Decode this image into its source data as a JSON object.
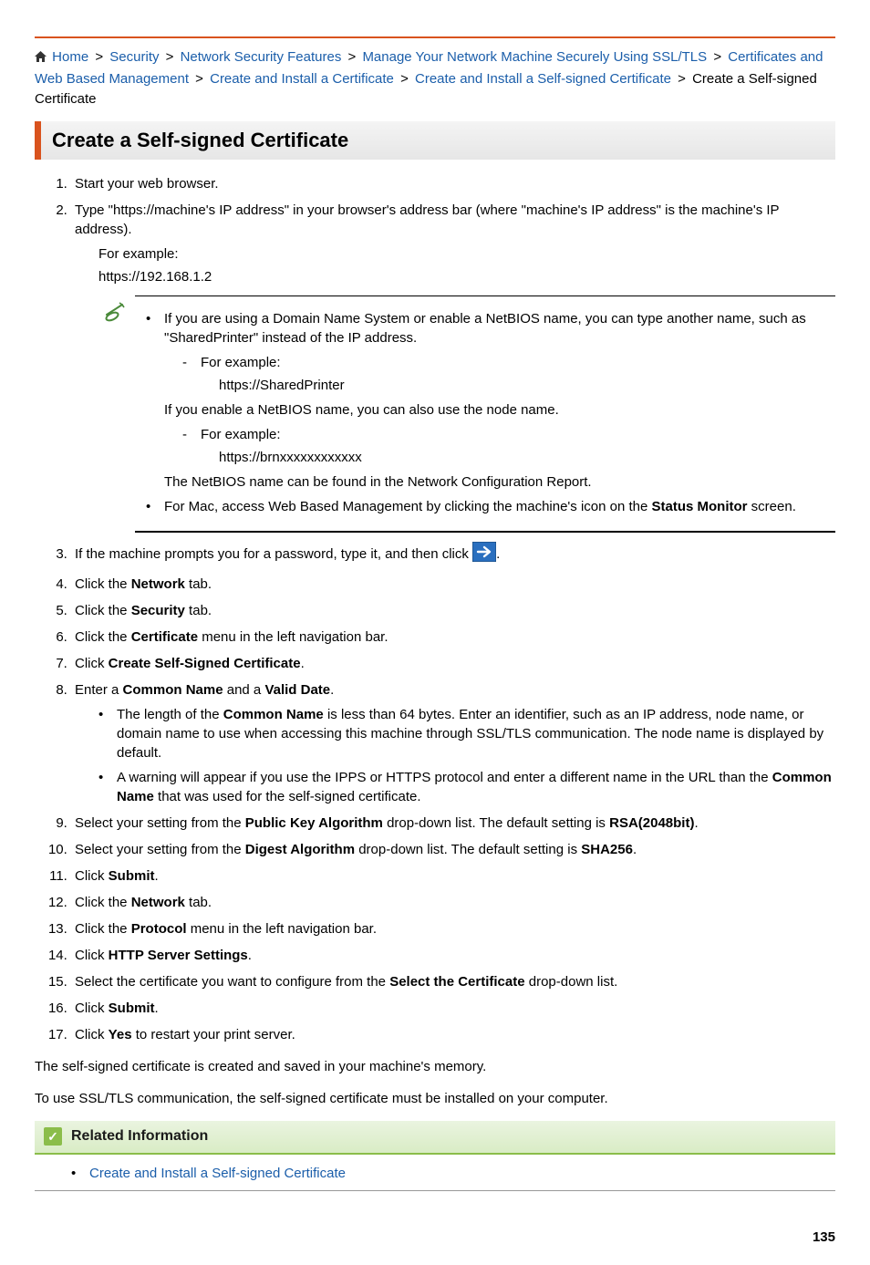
{
  "breadcrumb": {
    "home": "Home",
    "items": [
      "Security",
      "Network Security Features",
      "Manage Your Network Machine Securely Using SSL/TLS",
      "Certificates and Web Based Management",
      "Create and Install a Certificate",
      "Create and Install a Self-signed Certificate"
    ],
    "current": "Create a Self-signed Certificate",
    "sep": ">"
  },
  "title": "Create a Self-signed Certificate",
  "steps": {
    "s1": "Start your web browser.",
    "s2": "Type \"https://machine's IP address\" in your browser's address bar (where \"machine's IP address\" is the machine's IP address).",
    "s2_eg_label": "For example:",
    "s2_eg_value": "https://192.168.1.2",
    "note": {
      "b1": "If you are using a Domain Name System or enable a NetBIOS name, you can type another name, such as \"SharedPrinter\" instead of the IP address.",
      "b1_eg_label": "For example:",
      "b1_eg_value": "https://SharedPrinter",
      "b1_p2": "If you enable a NetBIOS name, you can also use the node name.",
      "b1_eg2_label": "For example:",
      "b1_eg2_value": "https://brnxxxxxxxxxxxx",
      "b1_p3": "The NetBIOS name can be found in the Network Configuration Report.",
      "b2_pre": "For Mac, access Web Based Management by clicking the machine's icon on the ",
      "b2_bold": "Status Monitor",
      "b2_post": " screen."
    },
    "s3_pre": "If the machine prompts you for a password, type it, and then click ",
    "s3_post": ".",
    "s4_pre": "Click the ",
    "s4_bold": "Network",
    "s4_post": " tab.",
    "s5_pre": "Click the ",
    "s5_bold": "Security",
    "s5_post": " tab.",
    "s6_pre": "Click the ",
    "s6_bold": "Certificate",
    "s6_post": " menu in the left navigation bar.",
    "s7_pre": "Click ",
    "s7_bold": "Create Self-Signed Certificate",
    "s7_post": ".",
    "s8_pre": "Enter a ",
    "s8_b1": "Common Name",
    "s8_mid": " and a ",
    "s8_b2": "Valid Date",
    "s8_post": ".",
    "s8_sub1_pre": "The length of the ",
    "s8_sub1_bold": "Common Name",
    "s8_sub1_post": " is less than 64 bytes. Enter an identifier, such as an IP address, node name, or domain name to use when accessing this machine through SSL/TLS communication. The node name is displayed by default.",
    "s8_sub2_pre": "A warning will appear if you use the IPPS or HTTPS protocol and enter a different name in the URL than the ",
    "s8_sub2_bold": "Common Name",
    "s8_sub2_post": " that was used for the self-signed certificate.",
    "s9_pre": "Select your setting from the ",
    "s9_bold": "Public Key Algorithm",
    "s9_mid": " drop-down list. The default setting is ",
    "s9_bold2": "RSA(2048bit)",
    "s9_post": ".",
    "s10_pre": "Select your setting from the ",
    "s10_bold": "Digest Algorithm",
    "s10_mid": " drop-down list. The default setting is ",
    "s10_bold2": "SHA256",
    "s10_post": ".",
    "s11_pre": "Click ",
    "s11_bold": "Submit",
    "s11_post": ".",
    "s12_pre": "Click the ",
    "s12_bold": "Network",
    "s12_post": " tab.",
    "s13_pre": "Click the ",
    "s13_bold": "Protocol",
    "s13_post": " menu in the left navigation bar.",
    "s14_pre": "Click ",
    "s14_bold": "HTTP Server Settings",
    "s14_post": ".",
    "s15_pre": "Select the certificate you want to configure from the ",
    "s15_bold": "Select the Certificate",
    "s15_post": " drop-down list.",
    "s16_pre": "Click ",
    "s16_bold": "Submit",
    "s16_post": ".",
    "s17_pre": "Click ",
    "s17_bold": "Yes",
    "s17_post": " to restart your print server."
  },
  "closing1": "The self-signed certificate is created and saved in your machine's memory.",
  "closing2": "To use SSL/TLS communication, the self-signed certificate must be installed on your computer.",
  "related": {
    "title": "Related Information",
    "link": "Create and Install a Self-signed Certificate"
  },
  "page_number": "135"
}
